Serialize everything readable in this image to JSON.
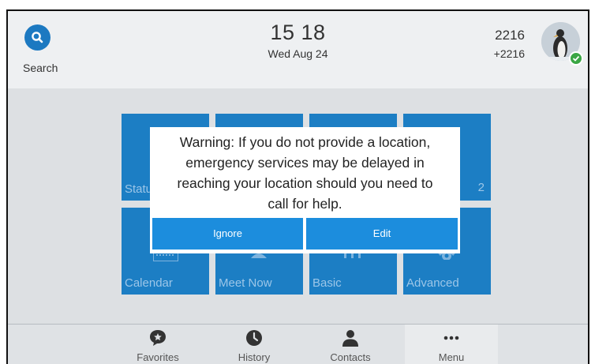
{
  "topbar": {
    "search_label": "Search",
    "time": "15 18",
    "date": "Wed Aug 24",
    "account_name": "2216",
    "account_number": "+2216"
  },
  "tiles": [
    {
      "label": "Statu"
    },
    {
      "label": ""
    },
    {
      "label": ""
    },
    {
      "label": "2"
    },
    {
      "label": "Calendar"
    },
    {
      "label": "Meet Now"
    },
    {
      "label": "Basic"
    },
    {
      "label": "Advanced"
    }
  ],
  "dialog": {
    "message_lines": [
      "Warning: If you do not provide a location,",
      "emergency services may be delayed in",
      "reaching your location should you need to",
      "call for help."
    ],
    "ignore_label": "Ignore",
    "edit_label": "Edit"
  },
  "softkeys": [
    {
      "label": "Favorites",
      "icon": "favorites-icon"
    },
    {
      "label": "History",
      "icon": "history-icon"
    },
    {
      "label": "Contacts",
      "icon": "contacts-icon"
    },
    {
      "label": "Menu",
      "icon": "more-icon"
    }
  ],
  "colors": {
    "tile": "#1c7ec4",
    "dialog_button": "#1c8ddd",
    "presence": "#3aa644"
  }
}
